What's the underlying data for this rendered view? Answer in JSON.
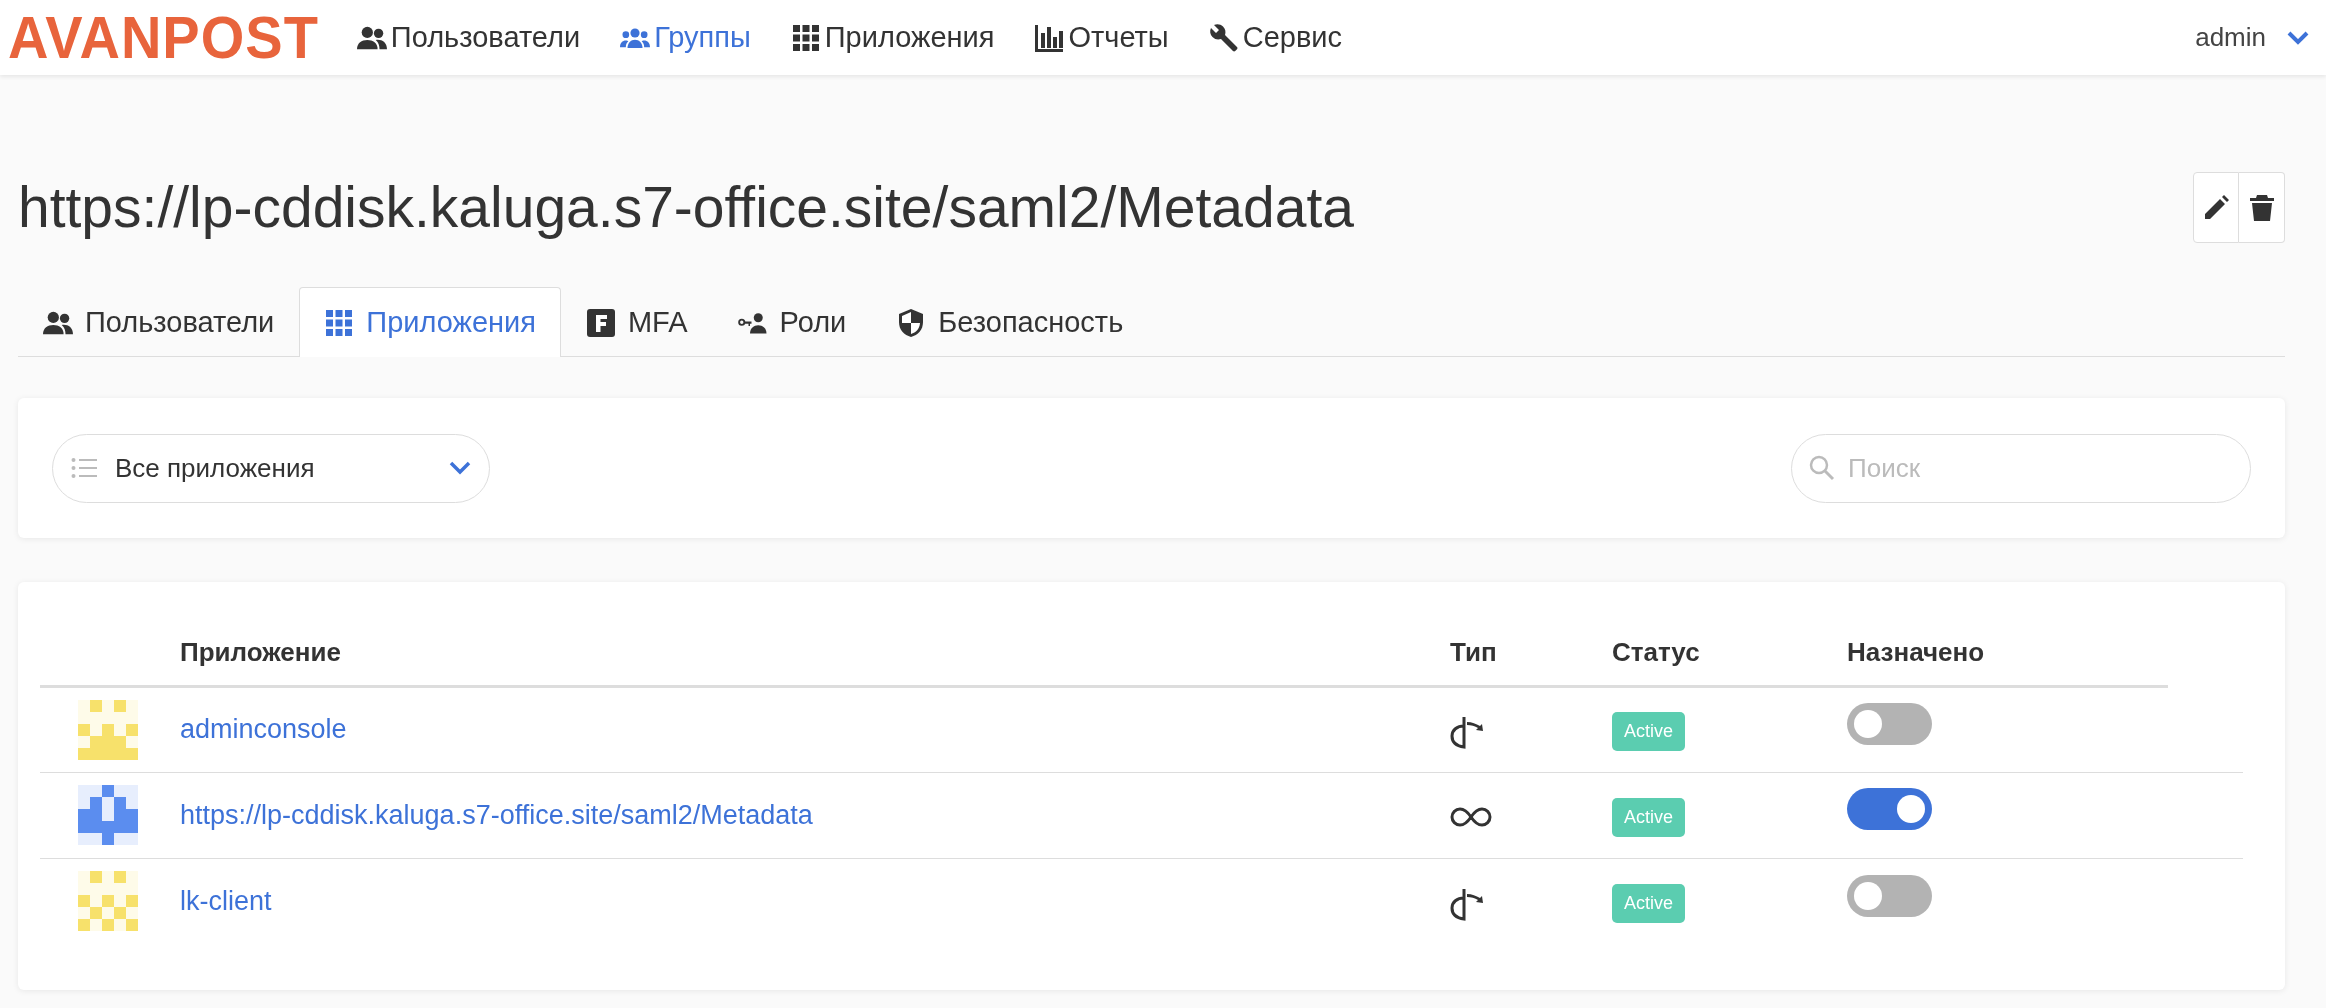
{
  "navbar": {
    "logo": "AVANPOST",
    "items": [
      {
        "label": "Пользователи",
        "kind": "users",
        "selected": false
      },
      {
        "label": "Группы",
        "kind": "groups",
        "selected": true
      },
      {
        "label": "Приложения",
        "kind": "grid",
        "selected": false
      },
      {
        "label": "Отчеты",
        "kind": "chart",
        "selected": false
      },
      {
        "label": "Сервис",
        "kind": "wrench",
        "selected": false
      }
    ],
    "user": "admin"
  },
  "page": {
    "title": "https://lp-cddisk.kaluga.s7-office.site/saml2/Metadata"
  },
  "tabs": [
    {
      "label": "Пользователи",
      "kind": "users",
      "selected": false
    },
    {
      "label": "Приложения",
      "kind": "grid",
      "selected": true
    },
    {
      "label": "MFA",
      "kind": "f",
      "selected": false
    },
    {
      "label": "Роли",
      "kind": "key",
      "selected": false
    },
    {
      "label": "Безопасность",
      "kind": "shield",
      "selected": false
    }
  ],
  "filter": {
    "dropdown": "Все приложения",
    "search": {
      "placeholder": "Поиск"
    }
  },
  "table": {
    "columns": [
      "Приложение",
      "Тип",
      "Статус",
      "Назначено"
    ],
    "rows": [
      {
        "name": "adminconsole",
        "color": "#f7e16b",
        "kind": "openid",
        "status": "Active",
        "assigned": false
      },
      {
        "name": "https://lp-cddisk.kaluga.s7-office.site/saml2/Metadata",
        "color": "#5b8def",
        "kind": "saml",
        "status": "Active",
        "assigned": true
      },
      {
        "name": "lk-client",
        "color": "#f7e16b",
        "kind": "openid",
        "status": "Active",
        "assigned": false
      }
    ]
  }
}
